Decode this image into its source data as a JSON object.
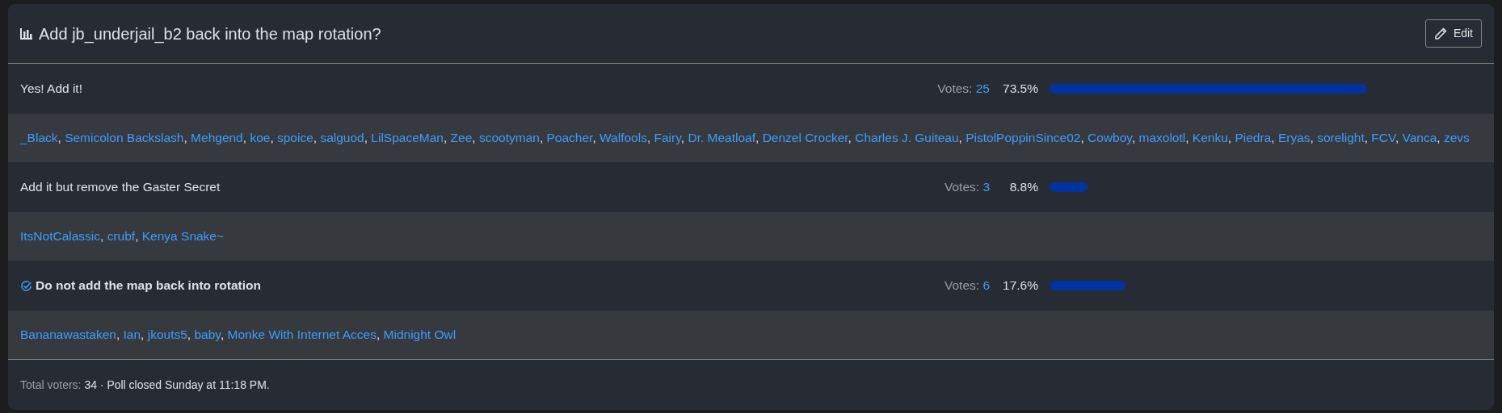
{
  "poll": {
    "title": "Add jb_underjail_b2 back into the map rotation?",
    "edit_button": "Edit",
    "options": [
      {
        "label": "Yes! Add it!",
        "selected": false,
        "votes_label": "Votes:",
        "votes": "25",
        "percent": "73.5%",
        "voters": [
          {
            "name": "_Black",
            "separator": ","
          },
          {
            "name": "Semicolon Backslash",
            "separator": ","
          },
          {
            "name": "Mehgend",
            "separator": ","
          },
          {
            "name": "koe",
            "separator": ","
          },
          {
            "name": "spoice",
            "separator": ","
          },
          {
            "name": "salguod",
            "separator": ","
          },
          {
            "name": "LilSpaceMan",
            "separator": ","
          },
          {
            "name": "Zee",
            "separator": ","
          },
          {
            "name": "scootyman",
            "separator": ","
          },
          {
            "name": "Poacher",
            "separator": ","
          },
          {
            "name": "Walfools",
            "separator": ","
          },
          {
            "name": "Fairy",
            "separator": ","
          },
          {
            "name": "Dr. Meatloaf",
            "separator": ","
          },
          {
            "name": "Denzel Crocker",
            "separator": ","
          },
          {
            "name": "Charles J. Guiteau",
            "separator": ","
          },
          {
            "name": "PistolPoppinSince02",
            "separator": ","
          },
          {
            "name": "Cowboy",
            "separator": ","
          },
          {
            "name": "maxolotl",
            "separator": ","
          },
          {
            "name": "Kenku",
            "separator": ","
          },
          {
            "name": "Piedra",
            "separator": ","
          },
          {
            "name": "Eryas",
            "separator": ","
          },
          {
            "name": "sorelight",
            "separator": ","
          },
          {
            "name": "FCV",
            "separator": ","
          },
          {
            "name": "Vanca",
            "separator": ","
          },
          {
            "name": "zevs"
          }
        ]
      },
      {
        "label": "Add it but remove the Gaster Secret",
        "selected": false,
        "votes_label": "Votes:",
        "votes": "3",
        "percent": "8.8%",
        "voters": [
          {
            "name": "ItsNotCalassic",
            "separator": ","
          },
          {
            "name": "crubf",
            "separator": ","
          },
          {
            "name": "Kenya Snake~"
          }
        ]
      },
      {
        "label": "Do not add the map back into rotation",
        "selected": true,
        "votes_label": "Votes:",
        "votes": "6",
        "percent": "17.6%",
        "voters": [
          {
            "name": "Bananawastaken",
            "separator": ","
          },
          {
            "name": "Ian",
            "separator": ","
          },
          {
            "name": "jkouts5",
            "separator": ","
          },
          {
            "name": "baby",
            "separator": ","
          },
          {
            "name": "Monke With Internet Acces",
            "separator": ","
          },
          {
            "name": "Midnight Owl"
          }
        ]
      }
    ],
    "footer": {
      "label": "Total voters:",
      "value": "34 · Poll closed Sunday at 11:18 PM."
    }
  }
}
